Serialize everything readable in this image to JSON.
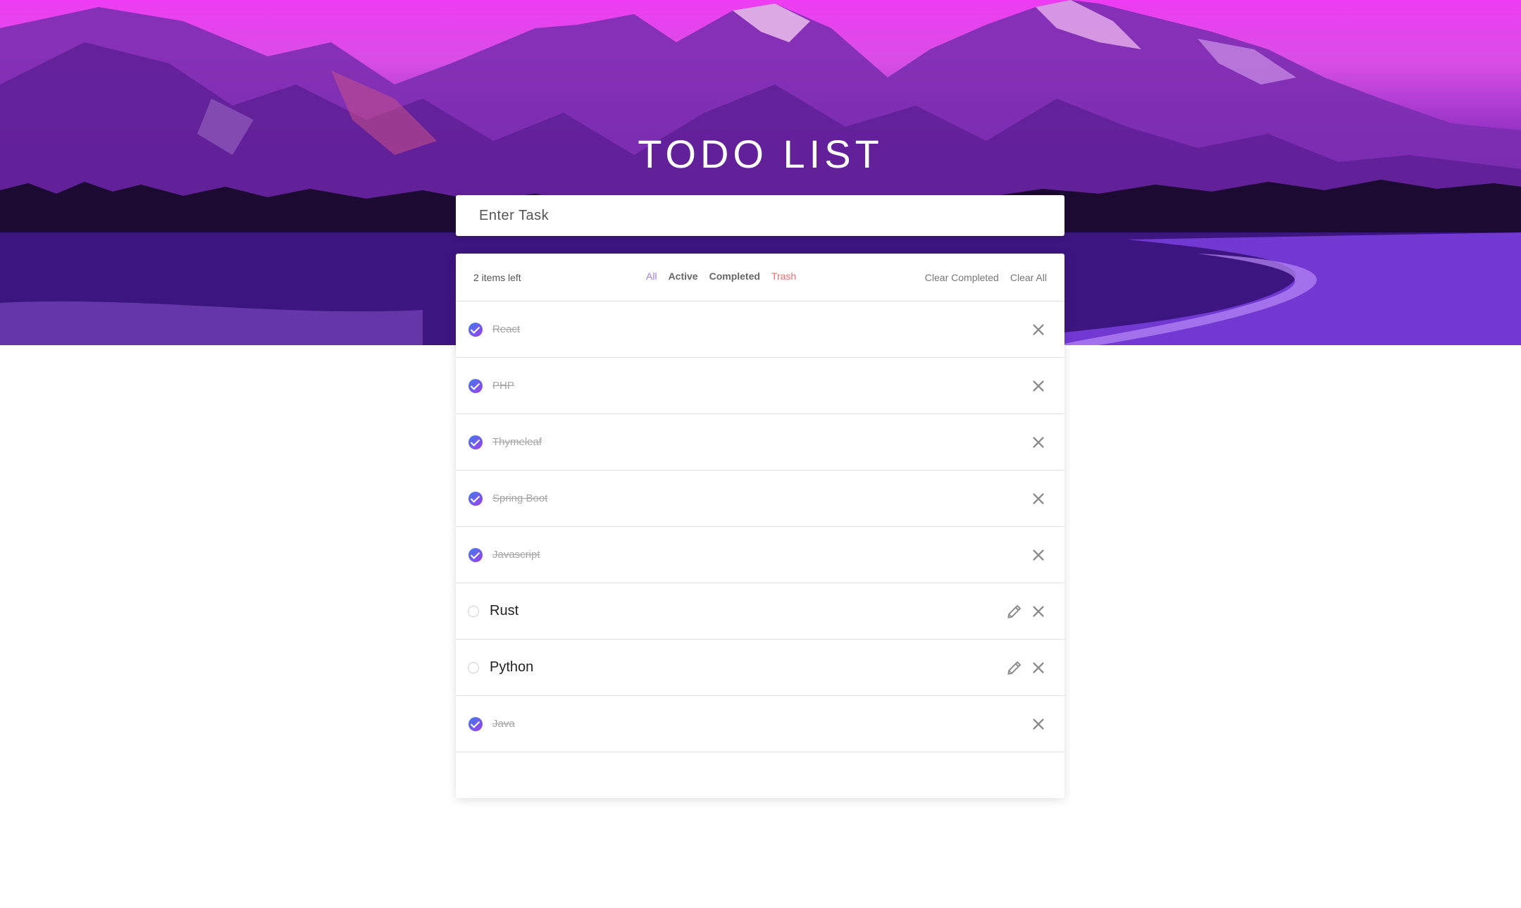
{
  "header": {
    "title": "TODO LIST"
  },
  "input": {
    "placeholder": "Enter Task"
  },
  "toolbar": {
    "items_left": "2 items left",
    "filters": {
      "all": "All",
      "active": "Active",
      "completed": "Completed",
      "trash": "Trash"
    },
    "clear_completed": "Clear Completed",
    "clear_all": "Clear All"
  },
  "tasks": [
    {
      "label": "React",
      "completed": true
    },
    {
      "label": "PHP",
      "completed": true
    },
    {
      "label": "Thymeleaf",
      "completed": true
    },
    {
      "label": "Spring Boot",
      "completed": true
    },
    {
      "label": "Javascript",
      "completed": true
    },
    {
      "label": "Rust",
      "completed": false
    },
    {
      "label": "Python",
      "completed": false
    },
    {
      "label": "Java",
      "completed": true
    }
  ],
  "colors": {
    "accent": "#9a7bf0",
    "trash": "#f26d6d",
    "check_gradient_start": "#3b7cf0",
    "check_gradient_end": "#a03ee8"
  },
  "icons": {
    "delete": "close-icon",
    "edit": "pencil-icon",
    "done": "check-icon"
  }
}
